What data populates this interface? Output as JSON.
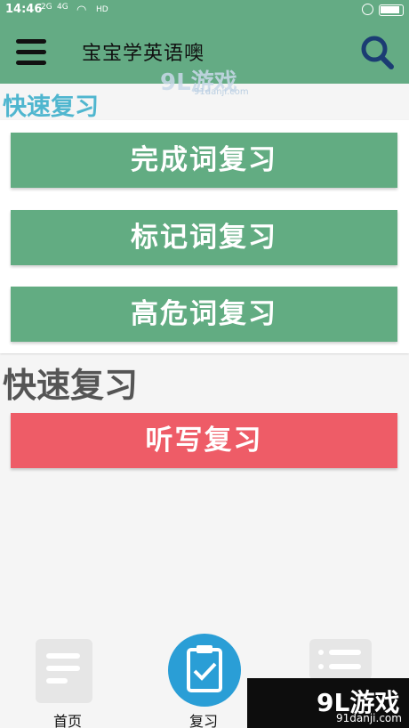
{
  "status_bar": {
    "time": "14:46",
    "signal_1": "2G",
    "signal_2": "4G",
    "hd": "HD"
  },
  "app_bar": {
    "title": "宝宝学英语噢"
  },
  "section_1": {
    "title": "快速复习",
    "buttons": [
      {
        "label": "完成词复习"
      },
      {
        "label": "标记词复习"
      },
      {
        "label": "高危词复习"
      }
    ]
  },
  "section_2": {
    "title": "快速复习",
    "button": {
      "label": "听写复习"
    }
  },
  "bottom_nav": {
    "items": [
      {
        "label": "首页",
        "icon": "document-edit-icon"
      },
      {
        "label": "复习",
        "icon": "clipboard-check-icon"
      },
      {
        "label": "",
        "icon": "list-icon"
      }
    ]
  },
  "watermark": {
    "logo": "9L游戏",
    "url": "91danji.com"
  },
  "colors": {
    "primary_green": "#64ab84",
    "button_green": "#62ac82",
    "button_red": "#ee5c67",
    "title_blue": "#4fb6cf",
    "nav_active": "#2a9ed6"
  }
}
